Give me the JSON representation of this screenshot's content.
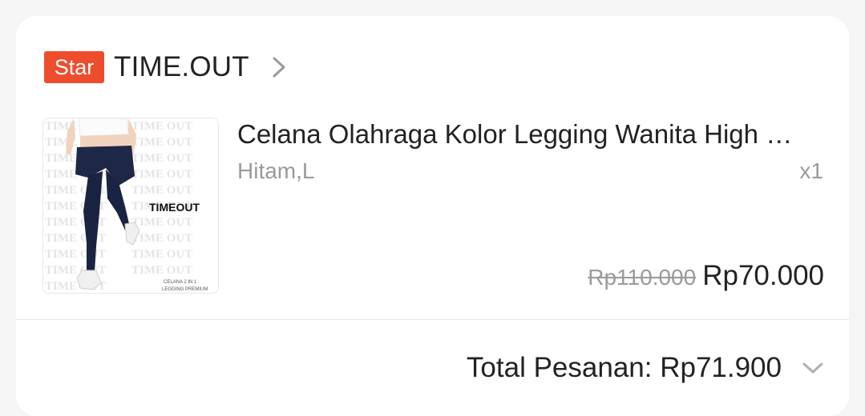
{
  "order": {
    "shop": {
      "badge": "Star",
      "name": "TIME.OUT",
      "chevron_icon": "chevron-right-icon"
    },
    "product": {
      "image_icon": "product-image-leggings",
      "image_brand": "TIMEOUT",
      "image_watermark": "TIME OUT",
      "image_caption_1": "CELANA 2 IN 1",
      "image_caption_2": "LEGGING PREMIUM",
      "title": "Celana Olahraga Kolor Legging Wanita High Waist",
      "variant": "Hitam,L",
      "quantity": "x1",
      "original_price": "Rp110.000",
      "price": "Rp70.000"
    },
    "total": {
      "label": "Total Pesanan: Rp71.900",
      "chevron_icon": "chevron-down-icon"
    }
  },
  "colors": {
    "badge_bg": "#ee4d2d",
    "text_primary": "#222222",
    "text_secondary": "#9a9a9a",
    "background": "#f5f5f5",
    "card": "#ffffff"
  }
}
